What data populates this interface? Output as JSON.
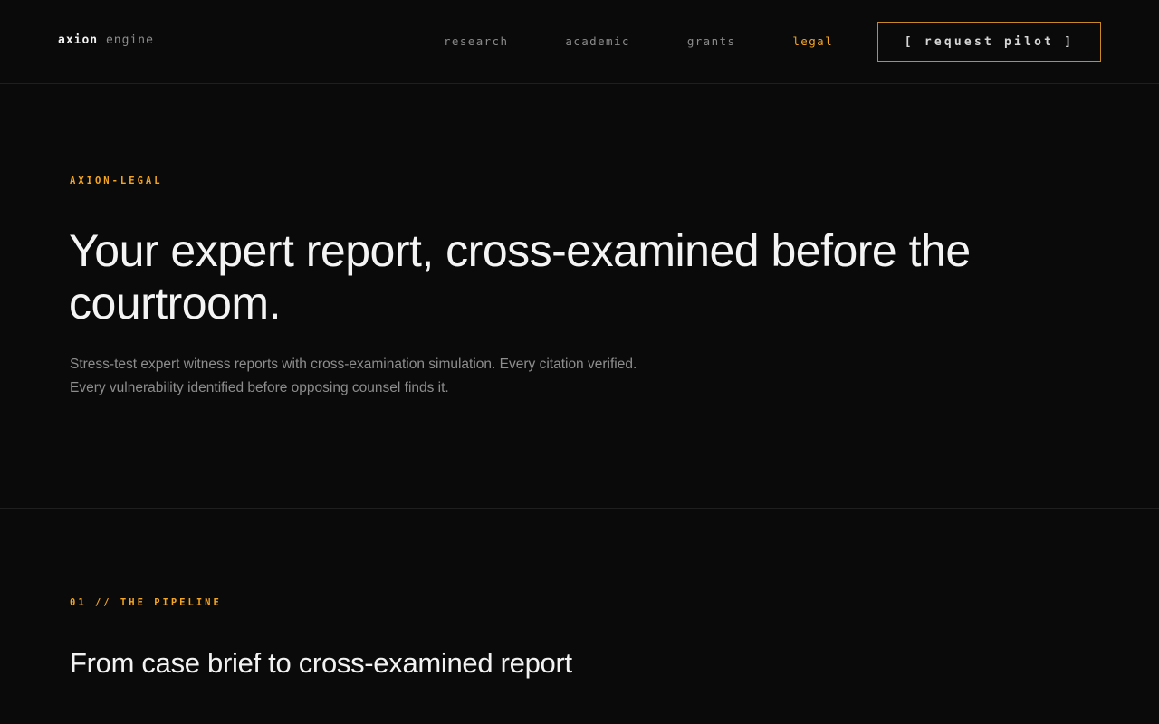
{
  "header": {
    "logo": {
      "primary": "axion",
      "secondary": "engine"
    },
    "nav": [
      {
        "label": "research",
        "active": false
      },
      {
        "label": "academic",
        "active": false
      },
      {
        "label": "grants",
        "active": false
      },
      {
        "label": "legal",
        "active": true
      }
    ],
    "cta_label": "[ request pilot ]"
  },
  "hero": {
    "eyebrow": "AXION-LEGAL",
    "title": "Your expert report, cross-examined before the courtroom.",
    "subtitle_lines": [
      "Stress-test expert witness reports with cross-examination simulation. Every citation verified.",
      "Every vulnerability identified before opposing counsel finds it."
    ]
  },
  "pipeline": {
    "label": "01 // THE PIPELINE",
    "title": "From case brief to cross-examined report"
  },
  "colors": {
    "background": "#0a0a0a",
    "accent": "#f5a623",
    "border": "#1f1f1f",
    "text_primary": "#f4f4f4",
    "text_muted": "#8d8d8d"
  }
}
